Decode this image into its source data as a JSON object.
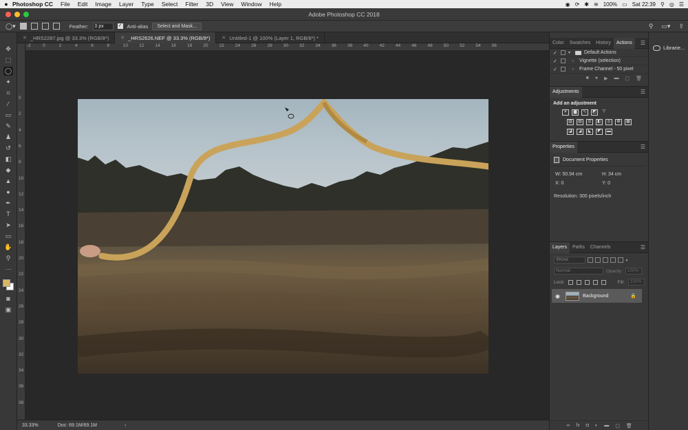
{
  "menubar": {
    "app_name": "Photoshop CC",
    "items": [
      "File",
      "Edit",
      "Image",
      "Layer",
      "Type",
      "Select",
      "Filter",
      "3D",
      "View",
      "Window",
      "Help"
    ],
    "battery": "100%",
    "clock": "Sat 22:39"
  },
  "window": {
    "title": "Adobe Photoshop CC 2018"
  },
  "options": {
    "feather_label": "Feather:",
    "feather_value": "0 px",
    "anti_alias_label": "Anti-alias",
    "select_mask_label": "Select and Mask..."
  },
  "tabs": [
    {
      "label": "_HRS2287.jpg @ 33.3% (RGB/8*)",
      "active": false
    },
    {
      "label": "_HRS2626.NEF @ 33.3% (RGB/8*)",
      "active": true
    },
    {
      "label": "Untitled-1 @ 100% (Layer 1, RGB/8*) *",
      "active": false
    }
  ],
  "ruler_h_ticks": [
    "-2",
    "0",
    "2",
    "4",
    "6",
    "8",
    "10",
    "12",
    "14",
    "16",
    "18",
    "20",
    "22",
    "24",
    "26",
    "28",
    "30",
    "32",
    "34",
    "36",
    "38",
    "40",
    "42",
    "44",
    "46",
    "48",
    "50",
    "52",
    "54",
    "56"
  ],
  "ruler_v_ticks": [
    "0",
    "2",
    "4",
    "6",
    "8",
    "10",
    "12",
    "14",
    "16",
    "18",
    "20",
    "22",
    "24",
    "26",
    "28",
    "30",
    "32",
    "34",
    "36",
    "38"
  ],
  "colors": {
    "foreground": "#d8b866",
    "background": "#ffffff",
    "ribbon": "#c9a35a"
  },
  "status": {
    "zoom": "33.33%",
    "doc_size": "Doc: 69.1M/69.1M"
  },
  "actions_panel": {
    "tabs": [
      "Color",
      "Swatches",
      "History",
      "Actions"
    ],
    "rows": [
      {
        "label": "Default Actions",
        "type": "folder"
      },
      {
        "label": "Vignette (selection)",
        "type": "action"
      },
      {
        "label": "Frame Channel - 50 pixel",
        "type": "action"
      }
    ]
  },
  "adjustments_panel": {
    "tab": "Adjustments",
    "hint": "Add an adjustment"
  },
  "properties_panel": {
    "tab": "Properties",
    "doc_label": "Document Properties",
    "w": "W: 50.94 cm",
    "h": "H: 34 cm",
    "x": "X: 0",
    "y": "Y: 0",
    "resolution": "Resolution: 300 pixels/inch"
  },
  "layers_panel": {
    "tabs": [
      "Layers",
      "Paths",
      "Channels"
    ],
    "kind": "Kind",
    "blend_mode": "Normal",
    "opacity_label": "Opacity:",
    "opacity_value": "100%",
    "lock_label": "Lock:",
    "fill_label": "Fill:",
    "fill_value": "100%",
    "layer_name": "Background"
  },
  "libraries": {
    "label": "Librarie..."
  }
}
